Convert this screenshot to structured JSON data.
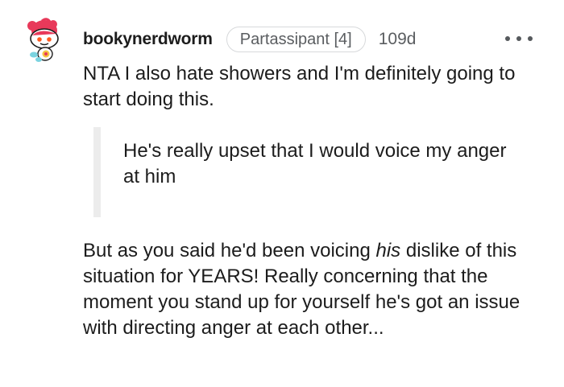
{
  "comment": {
    "username": "bookynerdworm",
    "flair": "Partassipant [4]",
    "age": "109d",
    "paragraph1": "NTA I also hate showers and I'm definitely going to start doing this.",
    "quote": "He's really upset that I would voice my anger at him",
    "paragraph2": {
      "before": "But as you said he'd been voicing ",
      "emphasis": "his",
      "after": " dislike of this situation for YEARS! Really concerning that the moment you stand up for yourself he's got an issue with directing anger at each other..."
    },
    "avatar_icon": "snoo-avatar-icon",
    "menu_icon": "more-options-icon"
  },
  "colors": {
    "text": "#1c1c1c",
    "meta": "#5a5d60",
    "flair_border": "#d7d9db",
    "quote_bar": "#ececec",
    "avatar_hair": "#e8395a"
  }
}
